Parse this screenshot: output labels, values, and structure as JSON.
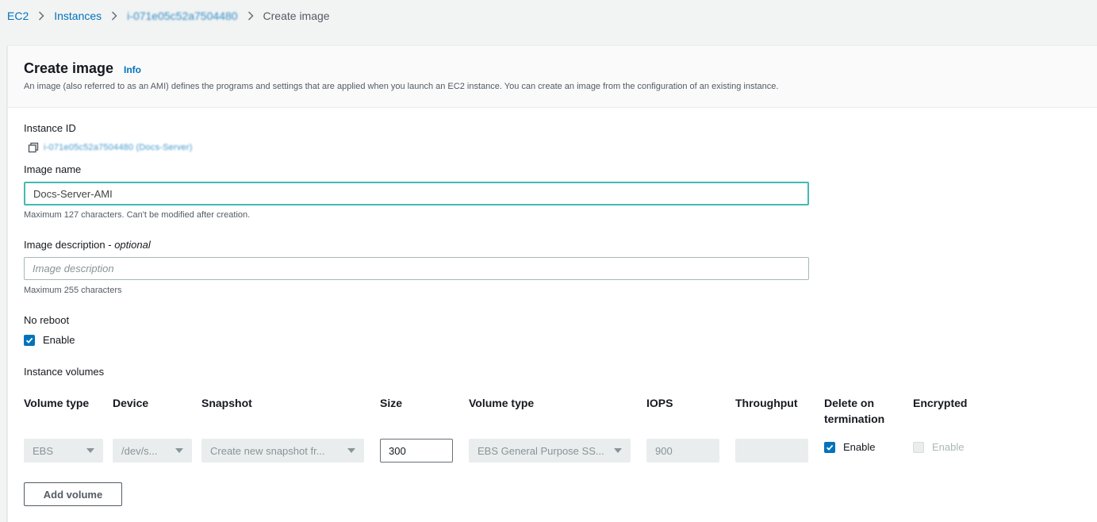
{
  "breadcrumb": {
    "ec2": "EC2",
    "instances": "Instances",
    "instance_id": "i-071e05c52a7504480",
    "current": "Create image"
  },
  "header": {
    "title": "Create image",
    "info": "Info",
    "description": "An image (also referred to as an AMI) defines the programs and settings that are applied when you launch an EC2 instance. You can create an image from the configuration of an existing instance."
  },
  "instance": {
    "label": "Instance ID",
    "value": "i-071e05c52a7504480 (Docs-Server)"
  },
  "image_name": {
    "label": "Image name",
    "value": "Docs-Server-AMI",
    "hint": "Maximum 127 characters. Can't be modified after creation."
  },
  "image_description": {
    "label": "Image description",
    "optional": "optional",
    "separator": " - ",
    "value": "",
    "placeholder": "Image description",
    "hint": "Maximum 255 characters"
  },
  "no_reboot": {
    "label": "No reboot",
    "checkbox_label": "Enable",
    "checked": true
  },
  "volumes": {
    "label": "Instance volumes",
    "columns": {
      "volume_type": "Volume type",
      "device": "Device",
      "snapshot": "Snapshot",
      "size": "Size",
      "ebs_volume_type": "Volume type",
      "iops": "IOPS",
      "throughput": "Throughput",
      "delete_on_termination_line1": "Delete on",
      "delete_on_termination_line2": "termination",
      "encrypted": "Encrypted"
    },
    "row": {
      "volume_type": "EBS",
      "device": "/dev/s...",
      "snapshot": "Create new snapshot fr...",
      "size": "300",
      "ebs_volume_type": "EBS General Purpose SS...",
      "iops": "900",
      "throughput": "",
      "delete_on_termination_label": "Enable",
      "delete_on_termination_checked": true,
      "encrypted_label": "Enable",
      "encrypted_checked": false
    },
    "add_button": "Add volume"
  },
  "colors": {
    "link": "#0073bb",
    "focus_border": "#44b9b6",
    "checkbox": "#0073bb"
  }
}
